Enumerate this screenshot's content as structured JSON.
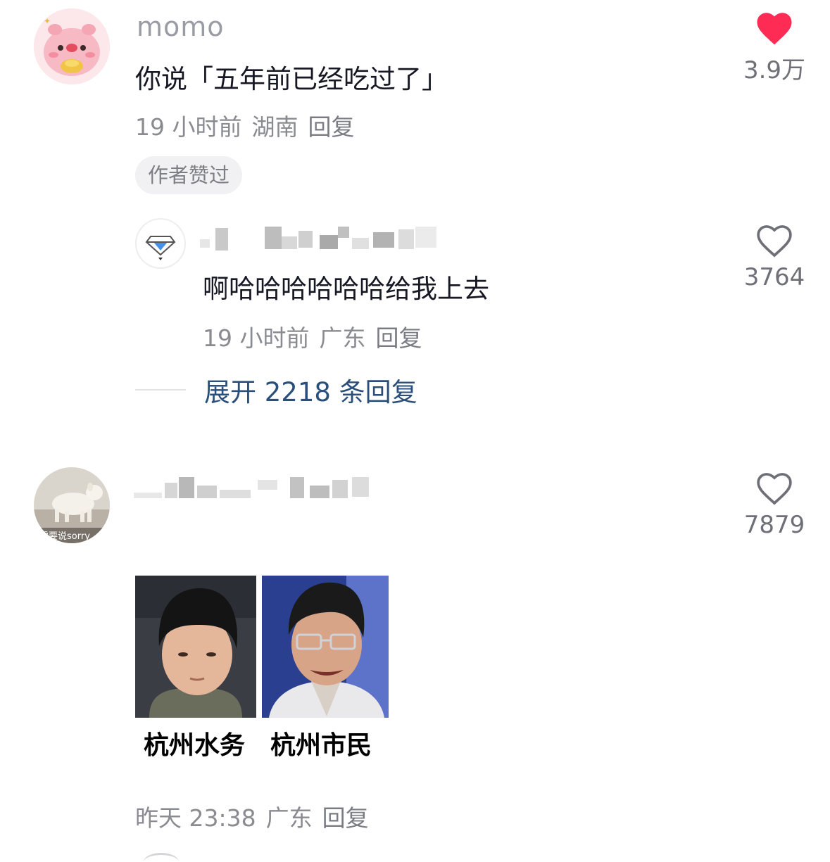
{
  "comment1": {
    "username": "momo",
    "text": "你说「五年前已经吃过了」",
    "time": "19 小时前",
    "location": "湖南",
    "reply_label": "回复",
    "tag": "作者赞过",
    "like_count": "3.9万",
    "liked": true,
    "like_color": "#fe2c55",
    "avatar_icon": "pink-pig-avatar-icon"
  },
  "reply1": {
    "text": "啊哈哈哈哈哈哈给我上去",
    "time": "19 小时前",
    "location": "广东",
    "reply_label": "回复",
    "like_count": "3764",
    "avatar_icon": "diamond-avatar-icon"
  },
  "expand": {
    "label": "展开 2218 条回复",
    "color": "#2b4f7b"
  },
  "comment2": {
    "avatar_caption": "需要说sorry",
    "like_count": "7879",
    "meme_caption_left": "杭州水务",
    "meme_caption_right": "杭州市民",
    "time": "昨天 23:38",
    "location": "广东",
    "reply_label": "回复"
  }
}
